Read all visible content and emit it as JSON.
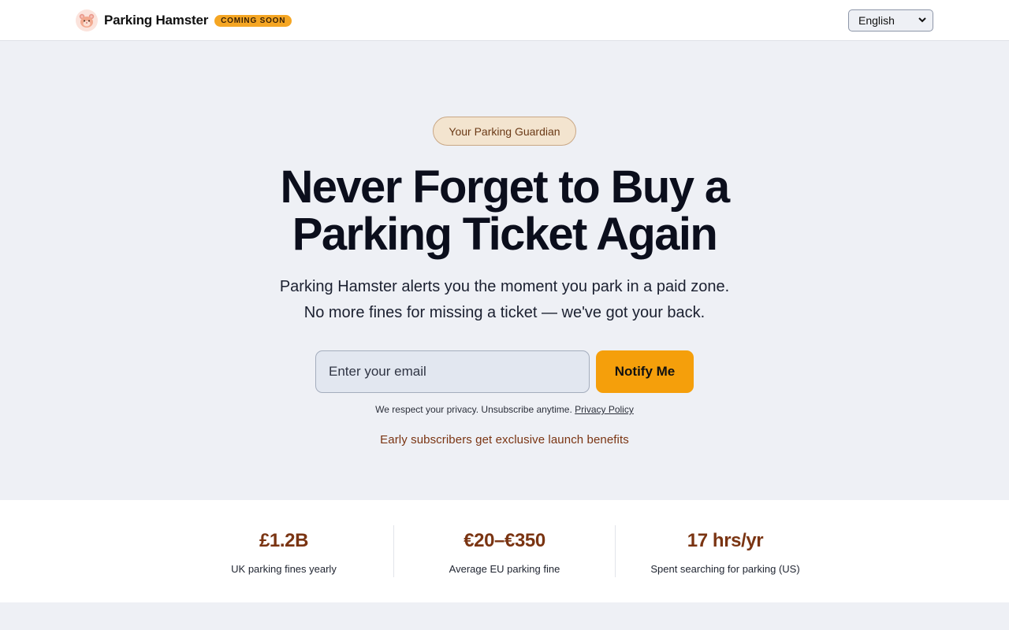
{
  "header": {
    "brand_name": "Parking Hamster",
    "badge": "COMING SOON",
    "language": "English",
    "logo_icon": "hamster-icon"
  },
  "hero": {
    "tagline": "Your Parking Guardian",
    "headline_line1": "Never Forget to Buy a",
    "headline_line2": "Parking Ticket Again",
    "sub_line1": "Parking Hamster alerts you the moment you park in a paid zone.",
    "sub_line2": "No more fines for missing a ticket — we've got your back.",
    "email_placeholder": "Enter your email",
    "notify_label": "Notify Me",
    "privacy_text": "We respect your privacy. Unsubscribe anytime.",
    "privacy_link": "Privacy Policy",
    "benefit": "Early subscribers get exclusive launch benefits"
  },
  "stats": [
    {
      "value": "£1.2B",
      "label": "UK parking fines yearly"
    },
    {
      "value": "€20–€350",
      "label": "Average EU parking fine"
    },
    {
      "value": "17 hrs/yr",
      "label": "Spent searching for parking (US)"
    }
  ],
  "colors": {
    "accent": "#f59f0b",
    "brown": "#7a3412",
    "background": "#eef0f5"
  }
}
